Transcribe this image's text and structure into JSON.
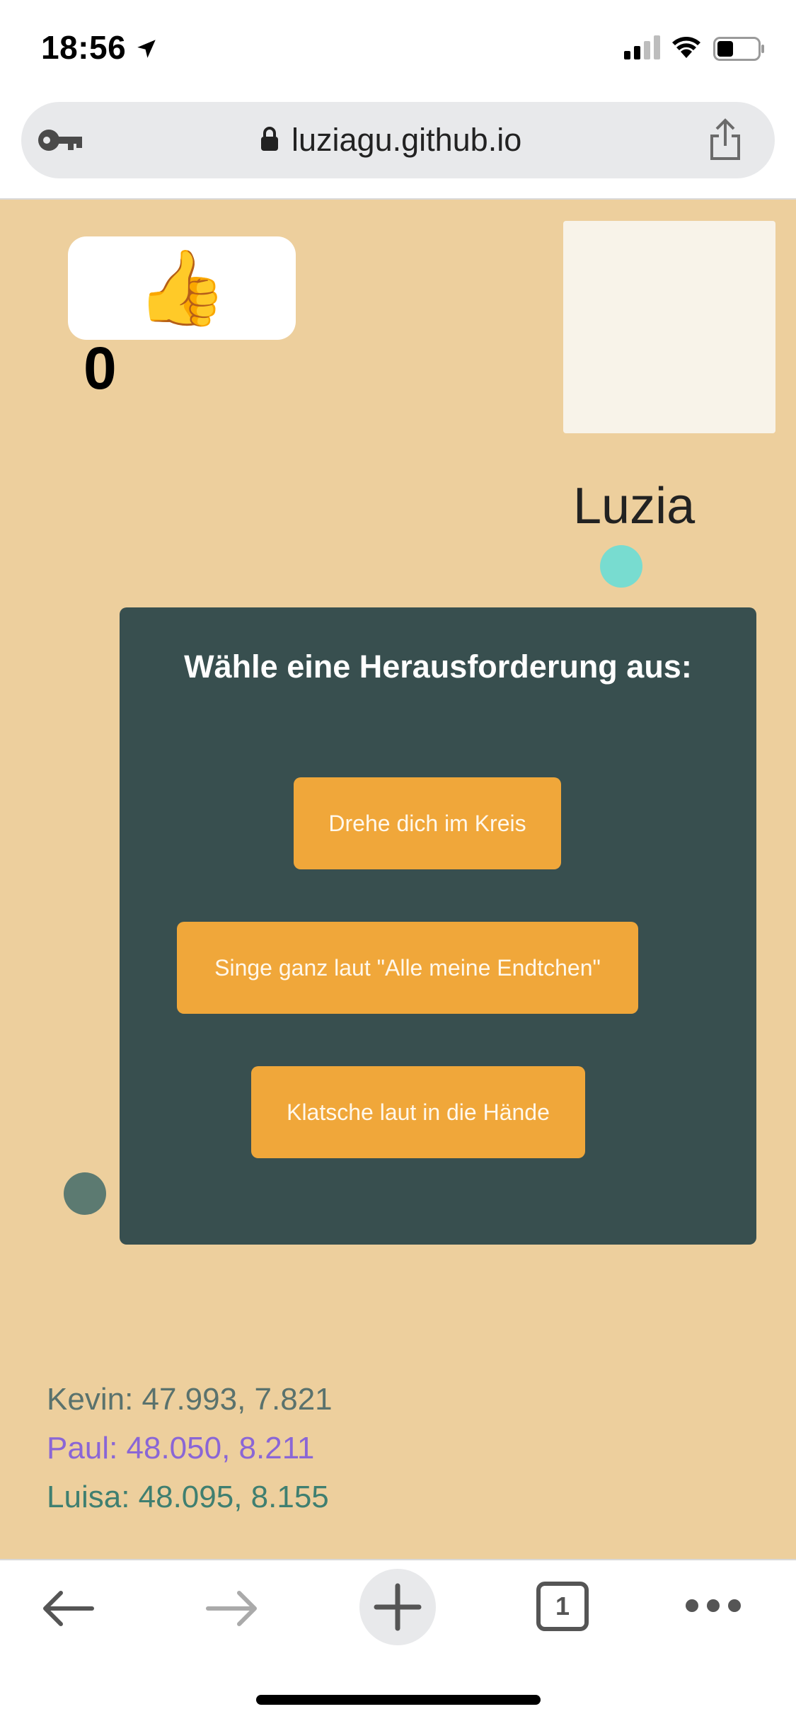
{
  "status_bar": {
    "time": "18:56"
  },
  "browser": {
    "url": "luziagu.github.io",
    "tab_count": "1"
  },
  "game": {
    "like_emoji": "👍",
    "like_count": "0",
    "player_name": "Luzia",
    "challenge": {
      "title": "Wähle eine Herausforderung aus:",
      "options": [
        "Drehe dich im Kreis",
        "Singe ganz laut \"Alle meine Endtchen\"",
        "Klatsche laut in die Hände"
      ]
    },
    "coordinates": [
      {
        "text": "Kevin: 47.993, 7.821",
        "color": "#5a726d"
      },
      {
        "text": "Paul: 48.050, 8.211",
        "color": "#8a66d6"
      },
      {
        "text": "Luisa: 48.095, 8.155",
        "color": "#3f7f70"
      }
    ]
  },
  "colors": {
    "background": "#edcf9d",
    "panel": "#384f4f",
    "button": "#f0a73a",
    "dot_teal": "#78dcd0",
    "dot_dark": "#5c7a71"
  }
}
